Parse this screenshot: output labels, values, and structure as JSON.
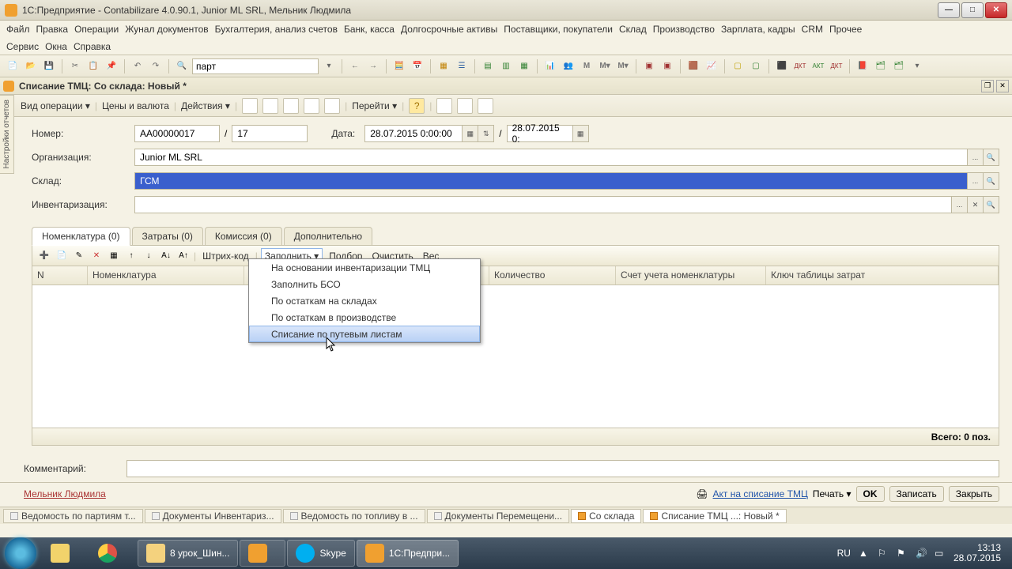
{
  "window": {
    "title": "1С:Предприятие - Contabilizare 4.0.90.1, Junior ML SRL, Мельник Людмила"
  },
  "menu": {
    "row1": [
      "Файл",
      "Правка",
      "Операции",
      "Жунал документов",
      "Бухгалтерия, анализ счетов",
      "Банк, касса",
      "Долгосрочные активы",
      "Поставщики, покупатели",
      "Склад",
      "Производство",
      "Зарплата, кадры",
      "CRM",
      "Прочее"
    ],
    "row2": [
      "Сервис",
      "Окна",
      "Справка"
    ]
  },
  "toolbar": {
    "search_value": "парт"
  },
  "sidetab": {
    "label": "Настройки отчетов"
  },
  "document": {
    "tab_title": "Списание ТМЦ: Со склада: Новый *",
    "cmd": {
      "op": "Вид операции ▾",
      "prices": "Цены и валюта",
      "actions": "Действия ▾",
      "goto": "Перейти ▾"
    },
    "fields": {
      "number_label": "Номер:",
      "number_value": "АА00000017",
      "number_seq": "17",
      "date_label": "Дата:",
      "date_value": "28.07.2015 0:00:00",
      "date2_value": "28.07.2015 0:",
      "org_label": "Организация:",
      "org_value": "Junior ML SRL",
      "store_label": "Склад:",
      "store_value": "ГСМ",
      "inv_label": "Инвентаризация:",
      "inv_value": ""
    },
    "tabs": [
      "Номенклатура (0)",
      "Затраты (0)",
      "Комиссия (0)",
      "Дополнительно"
    ],
    "grid_toolbar": {
      "barcode": "Штрих-код",
      "fill": "Заполнить ▾",
      "select": "Подбор",
      "clear": "Очистить",
      "weight": "Вес"
    },
    "grid_columns": [
      "N",
      "Номенклатура",
      "",
      "",
      "Количество",
      "Счет учета номенклатуры",
      "Ключ таблицы затрат"
    ],
    "grid_footer": "Всего: 0 поз.",
    "dropdown": [
      "На основании инвентаризации ТМЦ",
      "Заполнить БСО",
      "По остаткам на складах",
      "По остаткам в производстве",
      "Списание по путевым листам"
    ],
    "comment_label": "Комментарий:",
    "footer": {
      "author": "Мельник Людмила",
      "act": "Акт на списание ТМЦ",
      "print": "Печать ▾",
      "ok": "OK",
      "save": "Записать",
      "close": "Закрыть"
    }
  },
  "wintabs": [
    "Ведомость по партиям т...",
    "Документы Инвентариз...",
    "Ведомость по топливу в ...",
    "Документы Перемещени...",
    "Со склада",
    "Списание ТМЦ ...: Новый *"
  ],
  "taskbar": {
    "items": [
      {
        "label": "",
        "color": "#f2d36b"
      },
      {
        "label": "",
        "color": "#de5246"
      },
      {
        "label": "8 урок_Шин...",
        "color": "#f4d27e"
      },
      {
        "label": "",
        "color": "#f0a030"
      },
      {
        "label": "Skype",
        "color": "#00aff0"
      },
      {
        "label": "1С:Предпри...",
        "color": "#f0a030"
      }
    ],
    "lang": "RU",
    "time": "13:13",
    "date": "28.07.2015"
  }
}
